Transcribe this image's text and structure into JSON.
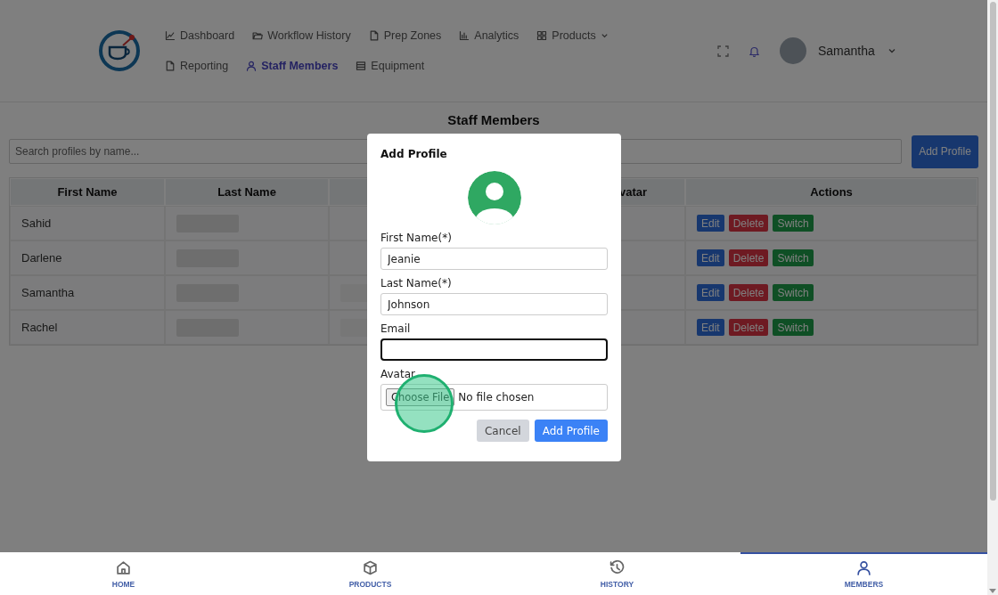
{
  "header": {
    "nav": [
      {
        "label": "Dashboard",
        "kind": "chart",
        "selected": false,
        "dropdown": false
      },
      {
        "label": "Workflow History",
        "kind": "folder",
        "selected": false,
        "dropdown": false
      },
      {
        "label": "Prep Zones",
        "kind": "file",
        "selected": false,
        "dropdown": false
      },
      {
        "label": "Analytics",
        "kind": "bars",
        "selected": false,
        "dropdown": false
      },
      {
        "label": "Products",
        "kind": "grid",
        "selected": false,
        "dropdown": true
      },
      {
        "label": "Reporting",
        "kind": "file",
        "selected": false,
        "dropdown": false
      },
      {
        "label": "Staff Members",
        "kind": "user",
        "selected": true,
        "dropdown": false
      },
      {
        "label": "Equipment",
        "kind": "list",
        "selected": false,
        "dropdown": false
      }
    ],
    "user": {
      "name": "Samantha"
    }
  },
  "page_title": "Staff Members",
  "search": {
    "placeholder": "Search profiles by name..."
  },
  "add_button": "Add Profile",
  "table": {
    "columns": [
      {
        "kind": "text",
        "label": "First Name"
      },
      {
        "kind": "text",
        "label": "Last Name"
      },
      {
        "kind": "covered"
      },
      {
        "kind": "cut",
        "label": "vatar"
      },
      {
        "kind": "text",
        "label": "Actions"
      }
    ],
    "rows": [
      {
        "first_name": "Sahid",
        "last_name_blurred": true,
        "column_3_blurred": false,
        "actions": [
          {
            "kind": "edit",
            "label": "Edit"
          },
          {
            "kind": "delete",
            "label": "Delete"
          },
          {
            "kind": "switch",
            "label": "Switch"
          }
        ]
      },
      {
        "first_name": "Darlene",
        "last_name_blurred": true,
        "column_3_blurred": false,
        "actions": [
          {
            "kind": "edit",
            "label": "Edit"
          },
          {
            "kind": "delete",
            "label": "Delete"
          },
          {
            "kind": "switch",
            "label": "Switch"
          }
        ]
      },
      {
        "first_name": "Samantha",
        "last_name_blurred": true,
        "column_3_blurred": true,
        "actions": [
          {
            "kind": "edit",
            "label": "Edit"
          },
          {
            "kind": "delete",
            "label": "Delete"
          },
          {
            "kind": "switch",
            "label": "Switch"
          }
        ]
      },
      {
        "first_name": "Rachel",
        "last_name_blurred": true,
        "column_3_blurred": true,
        "actions": [
          {
            "kind": "edit",
            "label": "Edit"
          },
          {
            "kind": "delete",
            "label": "Delete"
          },
          {
            "kind": "switch",
            "label": "Switch"
          }
        ]
      }
    ]
  },
  "modal": {
    "title": "Add Profile",
    "fields": [
      {
        "label": "First Name(*)",
        "value": "Jeanie",
        "focused": false
      },
      {
        "label": "Last Name(*)",
        "value": "Johnson",
        "focused": false
      },
      {
        "label": "Email",
        "focused": true
      }
    ],
    "avatar": {
      "label": "Avatar",
      "button": "Choose File",
      "status": "No file chosen"
    },
    "buttons": [
      {
        "kind": "secondary",
        "label": "Cancel"
      },
      {
        "kind": "primary",
        "label": "Add Profile"
      }
    ]
  },
  "bottom_nav": [
    {
      "label": "HOME",
      "kind": "home",
      "selected": false
    },
    {
      "label": "PRODUCTS",
      "kind": "box",
      "selected": false
    },
    {
      "label": "HISTORY",
      "kind": "history",
      "selected": false
    },
    {
      "label": "MEMBERS",
      "kind": "user",
      "selected": true
    }
  ]
}
